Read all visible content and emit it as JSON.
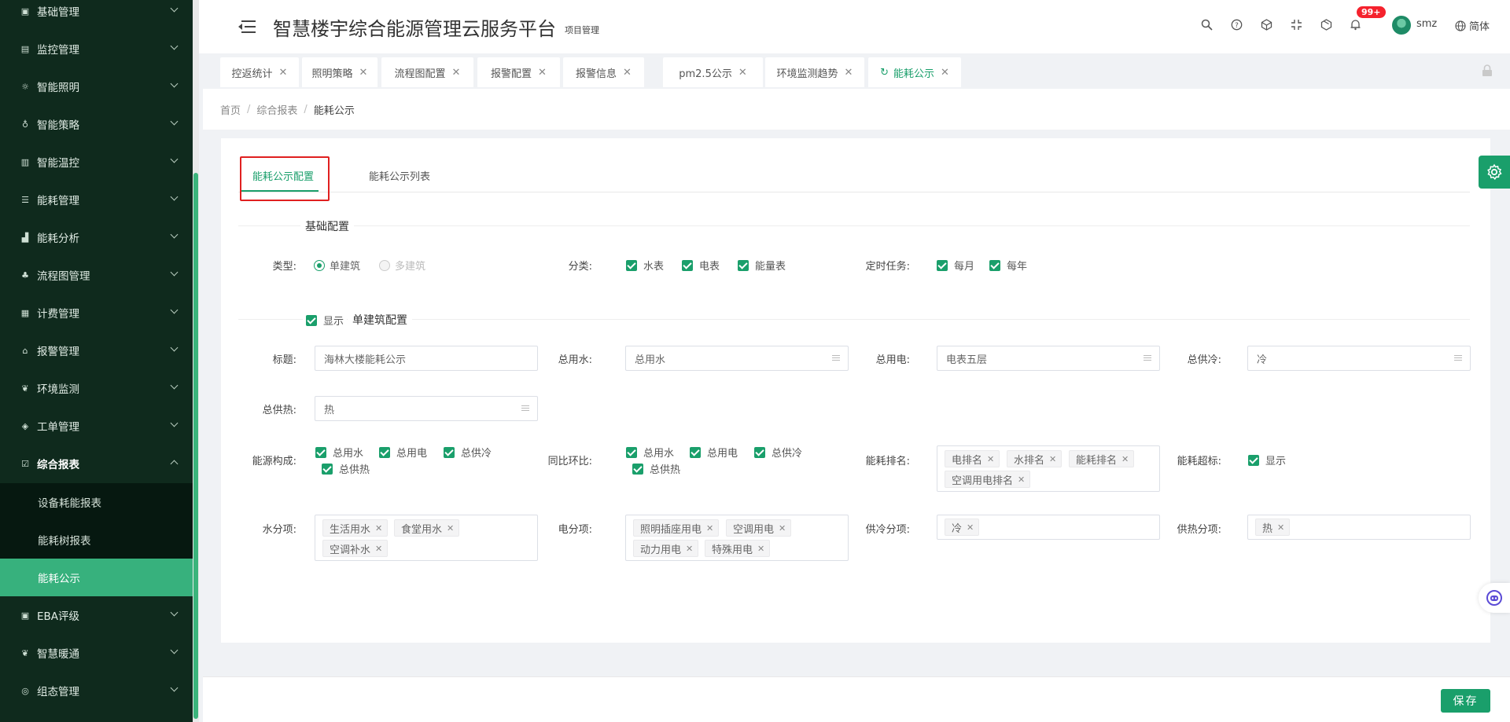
{
  "sidebar": {
    "items": [
      {
        "label": "基础管理",
        "icon": "calendar-icon"
      },
      {
        "label": "监控管理",
        "icon": "monitor-icon"
      },
      {
        "label": "智能照明",
        "icon": "sun-icon"
      },
      {
        "label": "智能策略",
        "icon": "bulb-icon"
      },
      {
        "label": "智能温控",
        "icon": "thermostat-icon"
      },
      {
        "label": "能耗管理",
        "icon": "sliders-icon"
      },
      {
        "label": "能耗分析",
        "icon": "bar-chart-icon"
      },
      {
        "label": "流程图管理",
        "icon": "flow-icon"
      },
      {
        "label": "计费管理",
        "icon": "billing-icon"
      },
      {
        "label": "报警管理",
        "icon": "alarm-icon"
      },
      {
        "label": "环境监测",
        "icon": "leaf-icon"
      },
      {
        "label": "工单管理",
        "icon": "layers-icon"
      },
      {
        "label": "综合报表",
        "icon": "report-icon"
      },
      {
        "label": "EBA评级",
        "icon": "grade-icon"
      },
      {
        "label": "智慧暖通",
        "icon": "hvac-icon"
      },
      {
        "label": "组态管理",
        "icon": "config-icon"
      }
    ],
    "sub_items": [
      "设备耗能报表",
      "能耗树报表",
      "能耗公示"
    ]
  },
  "header": {
    "title": "智慧楼宇综合能源管理云服务平台",
    "subtitle": "项目管理",
    "badge": "99+",
    "username": "smz",
    "language": "简体"
  },
  "tabs": [
    "控返统计",
    "照明策略",
    "流程图配置",
    "报警配置",
    "报警信息",
    "pm2.5公示",
    "环境监测趋势",
    "能耗公示"
  ],
  "breadcrumb": {
    "home": "首页",
    "parent": "综合报表",
    "current": "能耗公示"
  },
  "panel": {
    "tabs": [
      "能耗公示配置",
      "能耗公示列表"
    ],
    "basic_section": "基础配置",
    "type_label": "类型:",
    "type_options": [
      "单建筑",
      "多建筑"
    ],
    "category_label": "分类:",
    "category_options": [
      "水表",
      "电表",
      "能量表"
    ],
    "task_label": "定时任务:",
    "task_options": [
      "每月",
      "每年"
    ],
    "show_label": "显示",
    "single_section": "单建筑配置",
    "title_label": "标题:",
    "title_value": "海林大楼能耗公示",
    "water_total_label": "总用水:",
    "water_total_value": "总用水",
    "elec_total_label": "总用电:",
    "elec_total_value": "电表五层",
    "cool_total_label": "总供冷:",
    "cool_total_value": "冷",
    "heat_total_label": "总供热:",
    "heat_total_value": "热",
    "energy_comp_label": "能源构成:",
    "energy_comp_options": [
      "总用水",
      "总用电",
      "总供冷",
      "总供热"
    ],
    "yoy_label": "同比环比:",
    "yoy_options": [
      "总用水",
      "总用电",
      "总供冷",
      "总供热"
    ],
    "rank_label": "能耗排名:",
    "rank_tags": [
      "电排名",
      "水排名",
      "能耗排名",
      "空调用电排名"
    ],
    "over_label": "能耗超标:",
    "over_option": "显示",
    "water_sub_label": "水分项:",
    "water_sub_tags": [
      "生活用水",
      "食堂用水",
      "空调补水"
    ],
    "elec_sub_label": "电分项:",
    "elec_sub_tags": [
      "照明插座用电",
      "空调用电",
      "动力用电",
      "特殊用电"
    ],
    "cool_sub_label": "供冷分项:",
    "cool_sub_tags": [
      "冷"
    ],
    "heat_sub_label": "供热分项:",
    "heat_sub_tags": [
      "热"
    ]
  },
  "footer": {
    "save_label": "保存"
  },
  "colors": {
    "accent": "#1a9f6b",
    "sidebar_bg": "#0f2a1d",
    "active_sub": "#37b17d",
    "highlight": "#e02020"
  }
}
